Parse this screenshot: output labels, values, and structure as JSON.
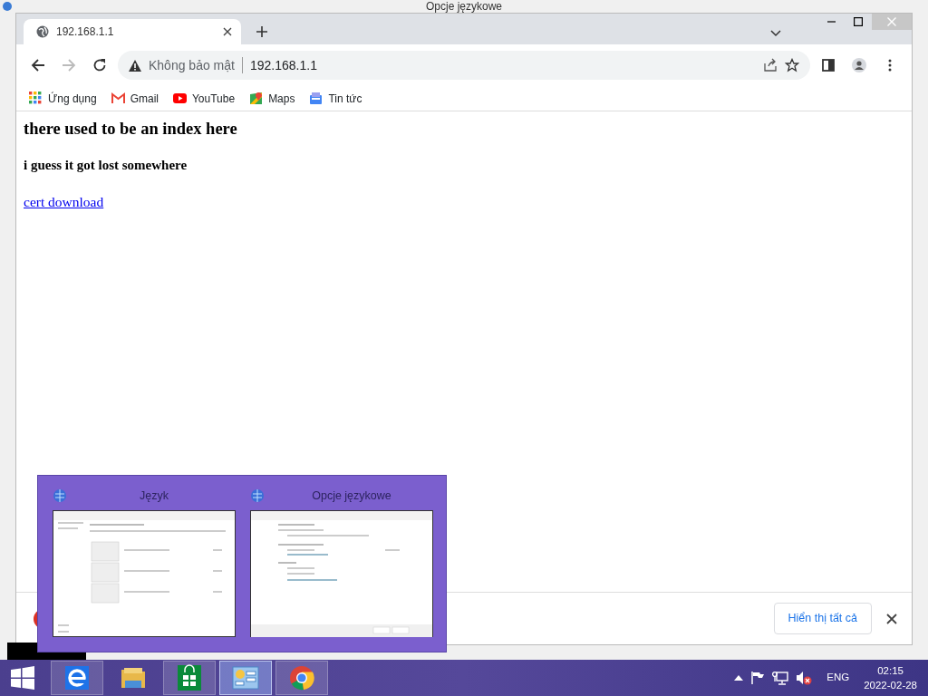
{
  "background_window": {
    "title": "Opcje językowe"
  },
  "browser": {
    "tabs": [
      {
        "title": "192.168.1.1",
        "selected": true
      }
    ],
    "navigation": {
      "back_disabled": false,
      "forward_disabled": true
    },
    "address": {
      "security": "Không bảo mật",
      "url": "192.168.1.1"
    },
    "bookmarks": [
      {
        "label": "Ứng dụng",
        "kind": "apps"
      },
      {
        "label": "Gmail",
        "kind": "gmail"
      },
      {
        "label": "YouTube",
        "kind": "youtube"
      },
      {
        "label": "Maps",
        "kind": "maps"
      },
      {
        "label": "Tin tức",
        "kind": "news"
      }
    ]
  },
  "page": {
    "heading": "there used to be an index here",
    "subheading": "i guess it got lost somewhere",
    "link": "cert download"
  },
  "download_bar": {
    "show_all": "Hiển thị tất cả"
  },
  "thumbnail_popup": {
    "windows": [
      {
        "title": "Język",
        "kind": "language"
      },
      {
        "title": "Opcje językowe",
        "kind": "options"
      }
    ]
  },
  "taskbar": {
    "apps": [
      {
        "kind": "ie",
        "running": true,
        "selected": false
      },
      {
        "kind": "explorer",
        "running": false,
        "selected": false
      },
      {
        "kind": "store",
        "running": true,
        "selected": false
      },
      {
        "kind": "control_panel",
        "running": true,
        "selected": true
      },
      {
        "kind": "chrome",
        "running": true,
        "selected": false
      }
    ],
    "tray": {
      "language": "ENG",
      "time": "02:15",
      "date": "2022-02-28"
    }
  }
}
